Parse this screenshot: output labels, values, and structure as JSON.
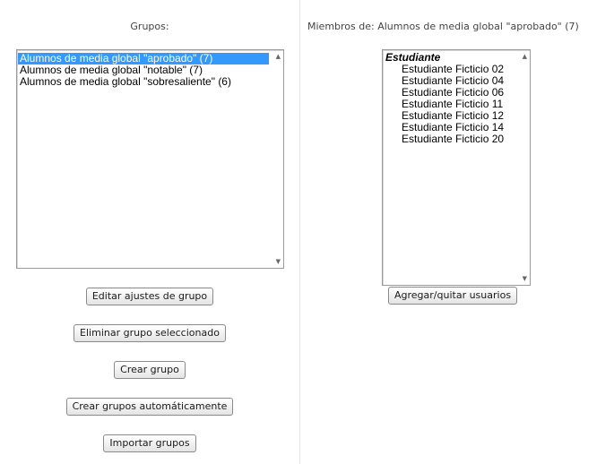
{
  "groups_panel": {
    "heading": "Grupos:",
    "groups": [
      {
        "label": "Alumnos de media global \"aprobado\" (7)",
        "selected": true
      },
      {
        "label": "Alumnos de media global \"notable\" (7)",
        "selected": false
      },
      {
        "label": "Alumnos de media global \"sobresaliente\" (6)",
        "selected": false
      }
    ],
    "buttons": {
      "edit_settings": "Editar ajustes de grupo",
      "delete_selected": "Eliminar grupo seleccionado",
      "create": "Crear grupo",
      "auto_create": "Crear grupos automáticamente",
      "import": "Importar grupos"
    }
  },
  "members_panel": {
    "heading": "Miembros de: Alumnos de media global \"aprobado\" (7)",
    "role_label": "Estudiante",
    "members": [
      "Estudiante Ficticio 02",
      "Estudiante Ficticio 04",
      "Estudiante Ficticio 06",
      "Estudiante Ficticio 11",
      "Estudiante Ficticio 12",
      "Estudiante Ficticio 14",
      "Estudiante Ficticio 20"
    ],
    "add_remove_button": "Agregar/quitar usuarios"
  },
  "colors": {
    "selection": "#3399ff"
  }
}
